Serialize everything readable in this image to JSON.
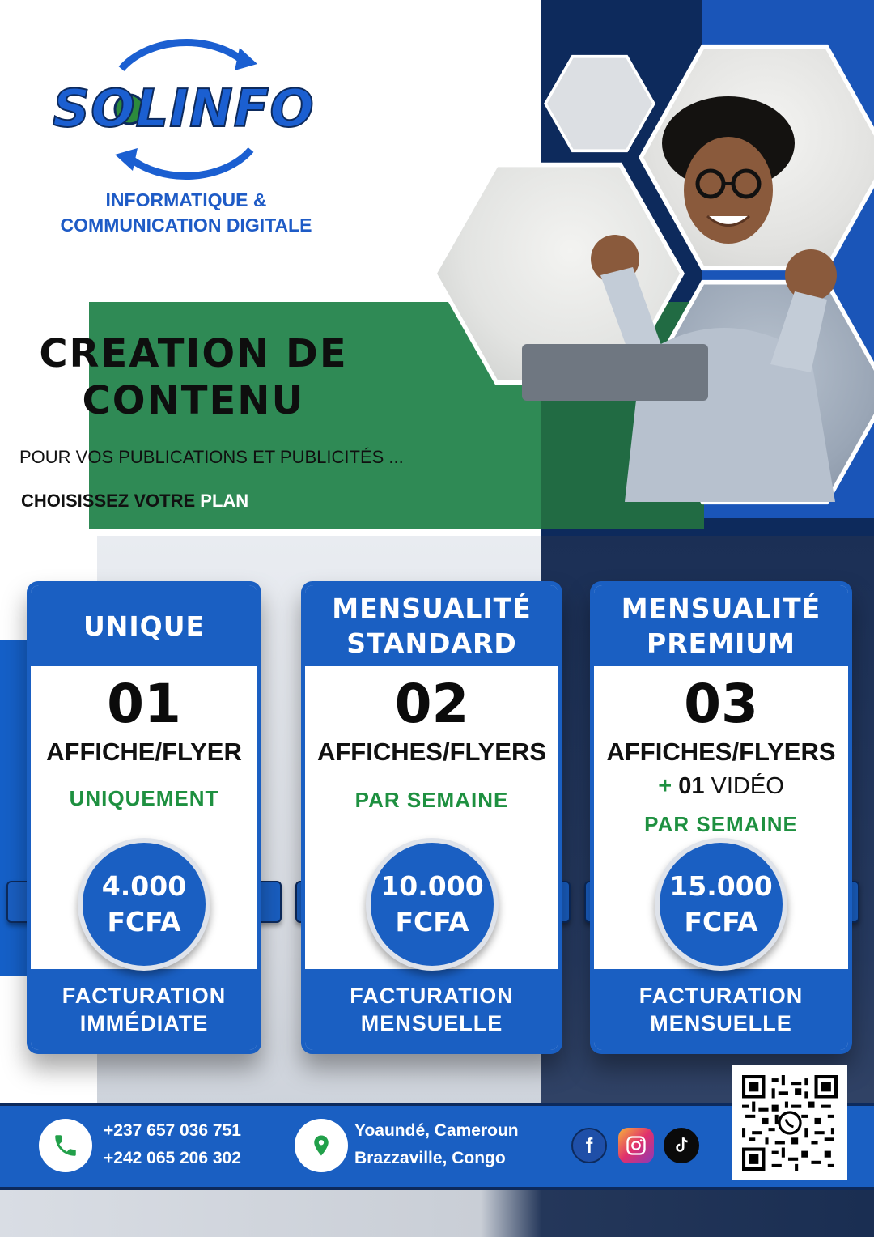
{
  "brand": {
    "logo_text": "SOLINFO",
    "tagline_line1": "INFORMATIQUE &",
    "tagline_line2": "COMMUNICATION DIGITALE"
  },
  "hero": {
    "title_line1": "CREATION DE",
    "title_line2": "CONTENU",
    "subtitle": "POUR VOS PUBLICATIONS ET PUBLICITÉS ...",
    "choose_prefix": "CHOISISSEZ VOTRE",
    "choose_highlight": "PLAN"
  },
  "plans": [
    {
      "header": "UNIQUE",
      "number": "01",
      "item": "AFFICHE/FLYER",
      "extra_plus": "",
      "extra_count": "",
      "extra_item": "",
      "period": "UNIQUEMENT",
      "price_amount": "4.000",
      "price_currency": "FCFA",
      "billing_line1": "FACTURATION",
      "billing_line2": "IMMÉDIATE"
    },
    {
      "header": "MENSUALITÉ STANDARD",
      "number": "02",
      "item": "AFFICHES/FLYERS",
      "extra_plus": "",
      "extra_count": "",
      "extra_item": "",
      "period": "PAR SEMAINE",
      "price_amount": "10.000",
      "price_currency": "FCFA",
      "billing_line1": "FACTURATION",
      "billing_line2": "MENSUELLE"
    },
    {
      "header": "MENSUALITÉ PREMIUM",
      "number": "03",
      "item": "AFFICHES/FLYERS",
      "extra_plus": "+",
      "extra_count": "01",
      "extra_item": "VIDÉO",
      "period": "PAR SEMAINE",
      "price_amount": "15.000",
      "price_currency": "FCFA",
      "billing_line1": "FACTURATION",
      "billing_line2": "MENSUELLE"
    }
  ],
  "contact": {
    "phone1": "+237 657 036 751",
    "phone2": "+242 065 206 302",
    "city1": "Yoaundé, Cameroun",
    "city2": "Brazzaville, Congo",
    "icons": [
      "phone-icon",
      "location-pin-icon",
      "facebook-icon",
      "instagram-icon",
      "tiktok-icon",
      "qr-code"
    ]
  },
  "colors": {
    "brand_blue": "#1a5fc2",
    "navy": "#0d2a5c",
    "green": "#2f8a55",
    "accent_green_text": "#1e9040"
  }
}
